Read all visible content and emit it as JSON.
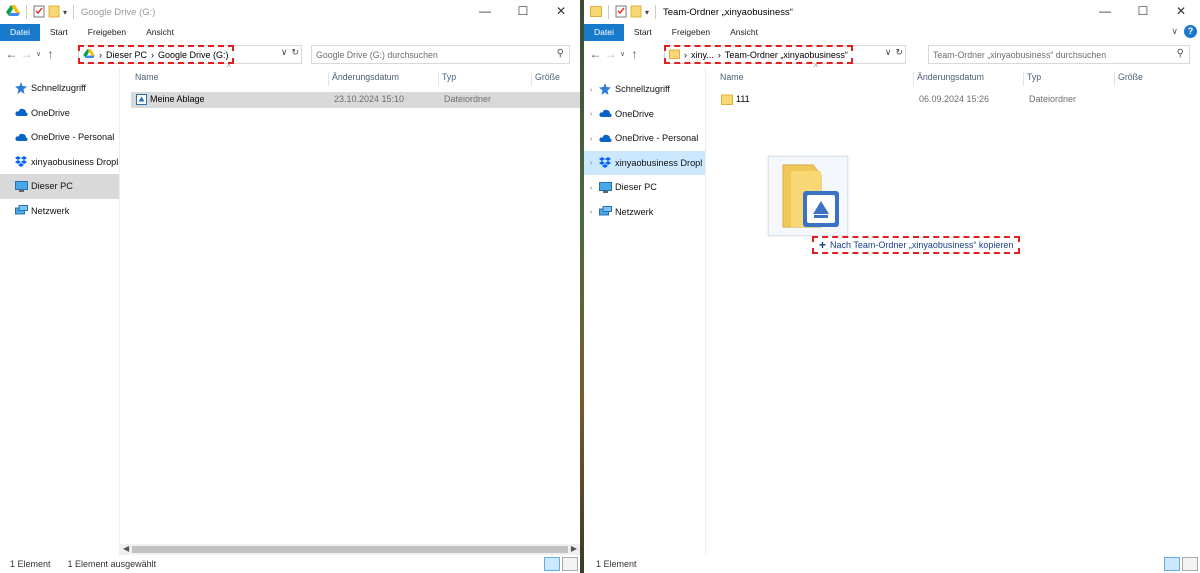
{
  "left": {
    "title": "Google Drive (G:)",
    "ribbon": {
      "file": "Datei",
      "start": "Start",
      "share": "Freigeben",
      "view": "Ansicht"
    },
    "breadcrumb": [
      "Dieser PC",
      "Google Drive (G:)"
    ],
    "search_placeholder": "Google Drive (G:) durchsuchen",
    "nav": [
      "Schnellzugriff",
      "OneDrive",
      "OneDrive - Personal",
      "xinyaobusiness Dropl",
      "Dieser PC",
      "Netzwerk"
    ],
    "columns": {
      "name": "Name",
      "date": "Änderungsdatum",
      "type": "Typ",
      "size": "Größe"
    },
    "rows": [
      {
        "name": "Meine Ablage",
        "date": "23.10.2024 15:10",
        "type": "Dateiordner"
      }
    ],
    "status": {
      "count": "1 Element",
      "selected": "1 Element ausgewählt"
    }
  },
  "right": {
    "title": "Team-Ordner „xinyaobusiness“",
    "ribbon": {
      "file": "Datei",
      "start": "Start",
      "share": "Freigeben",
      "view": "Ansicht"
    },
    "breadcrumb": [
      "xiny...",
      "Team-Ordner „xinyaobusiness“"
    ],
    "search_placeholder": "Team-Ordner „xinyaobusiness“ durchsuchen",
    "nav": [
      "Schnellzugriff",
      "OneDrive",
      "OneDrive - Personal",
      "xinyaobusiness Dropl",
      "Dieser PC",
      "Netzwerk"
    ],
    "columns": {
      "name": "Name",
      "date": "Änderungsdatum",
      "type": "Typ",
      "size": "Größe"
    },
    "rows": [
      {
        "name": "111",
        "date": "06.09.2024 15:26",
        "type": "Dateiordner"
      }
    ],
    "status": {
      "count": "1 Element"
    }
  },
  "drag": {
    "tooltip": "Nach Team-Ordner „xinyaobusiness“ kopieren"
  },
  "colors": {
    "accent": "#1979ca",
    "highlight": "#e02020",
    "selection": "#cce8ff"
  }
}
